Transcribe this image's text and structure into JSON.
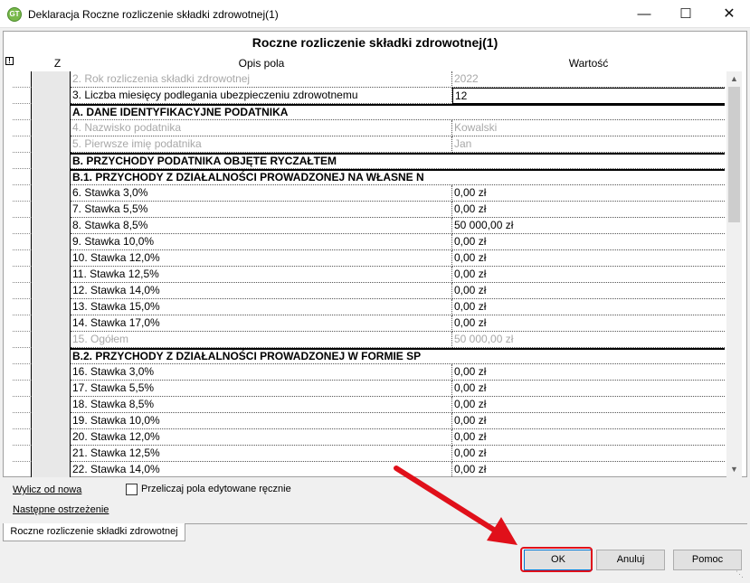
{
  "window": {
    "title": "Deklaracja Roczne rozliczenie składki zdrowotnej(1)",
    "app_icon": "app-logo-icon",
    "controls": [
      "minimize-icon",
      "maximize-icon",
      "close-icon"
    ]
  },
  "form": {
    "header": "Roczne rozliczenie składki zdrowotnej(1)",
    "columns": {
      "z": "Z",
      "desc": "Opis pola",
      "value": "Wartość"
    },
    "warning_marker": "!",
    "rows": [
      {
        "type": "field",
        "desc": "2. Rok rozliczenia składki zdrowotnej",
        "value": "2022",
        "readonly": true
      },
      {
        "type": "field",
        "desc": "3. Liczba miesięcy podlegania ubezpieczeniu zdrowotnemu",
        "value": "12",
        "readonly": false,
        "highlight": true
      },
      {
        "type": "section",
        "desc": "A. DANE IDENTYFIKACYJNE PODATNIKA"
      },
      {
        "type": "field",
        "desc": "4. Nazwisko podatnika",
        "value": "Kowalski",
        "readonly": true
      },
      {
        "type": "field",
        "desc": "5. Pierwsze imię podatnika",
        "value": "Jan",
        "readonly": true
      },
      {
        "type": "section",
        "desc": "B. PRZYCHODY PODATNIKA OBJĘTE RYCZAŁTEM"
      },
      {
        "type": "section",
        "desc": "B.1. PRZYCHODY Z DZIAŁALNOŚCI PROWADZONEJ NA WŁASNE N"
      },
      {
        "type": "field",
        "desc": "6. Stawka 3,0%",
        "value": "0,00 zł"
      },
      {
        "type": "field",
        "desc": "7. Stawka 5,5%",
        "value": "0,00 zł"
      },
      {
        "type": "field",
        "desc": "8. Stawka 8,5%",
        "value": "50 000,00 zł"
      },
      {
        "type": "field",
        "desc": "9. Stawka 10,0%",
        "value": "0,00 zł"
      },
      {
        "type": "field",
        "desc": "10. Stawka 12,0%",
        "value": "0,00 zł"
      },
      {
        "type": "field",
        "desc": "11. Stawka 12,5%",
        "value": "0,00 zł"
      },
      {
        "type": "field",
        "desc": "12. Stawka 14,0%",
        "value": "0,00 zł"
      },
      {
        "type": "field",
        "desc": "13. Stawka 15,0%",
        "value": "0,00 zł"
      },
      {
        "type": "field",
        "desc": "14. Stawka 17,0%",
        "value": "0,00 zł"
      },
      {
        "type": "field",
        "desc": "15. Ogółem",
        "value": "50 000,00 zł",
        "readonly": true
      },
      {
        "type": "section",
        "desc": "B.2. PRZYCHODY Z DZIAŁALNOŚCI PROWADZONEJ W FORMIE SP"
      },
      {
        "type": "field",
        "desc": "16. Stawka 3,0%",
        "value": "0,00 zł"
      },
      {
        "type": "field",
        "desc": "17. Stawka 5,5%",
        "value": "0,00 zł"
      },
      {
        "type": "field",
        "desc": "18. Stawka 8,5%",
        "value": "0,00 zł"
      },
      {
        "type": "field",
        "desc": "19. Stawka 10,0%",
        "value": "0,00 zł"
      },
      {
        "type": "field",
        "desc": "20. Stawka 12,0%",
        "value": "0,00 zł"
      },
      {
        "type": "field",
        "desc": "21. Stawka 12,5%",
        "value": "0,00 zł"
      },
      {
        "type": "field",
        "desc": "22. Stawka 14,0%",
        "value": "0,00 zł"
      }
    ]
  },
  "links": {
    "recalculate": "Wylicz od nowa",
    "next_warning": "Następne ostrzeżenie"
  },
  "checkbox": {
    "label": "Przeliczaj pola edytowane ręcznie",
    "checked": false
  },
  "tab": {
    "label": "Roczne rozliczenie składki zdrowotnej"
  },
  "buttons": {
    "ok": "OK",
    "cancel": "Anuluj",
    "help": "Pomoc"
  },
  "colors": {
    "annotation": "#e0101a",
    "ok_focus": "#0078d7"
  }
}
